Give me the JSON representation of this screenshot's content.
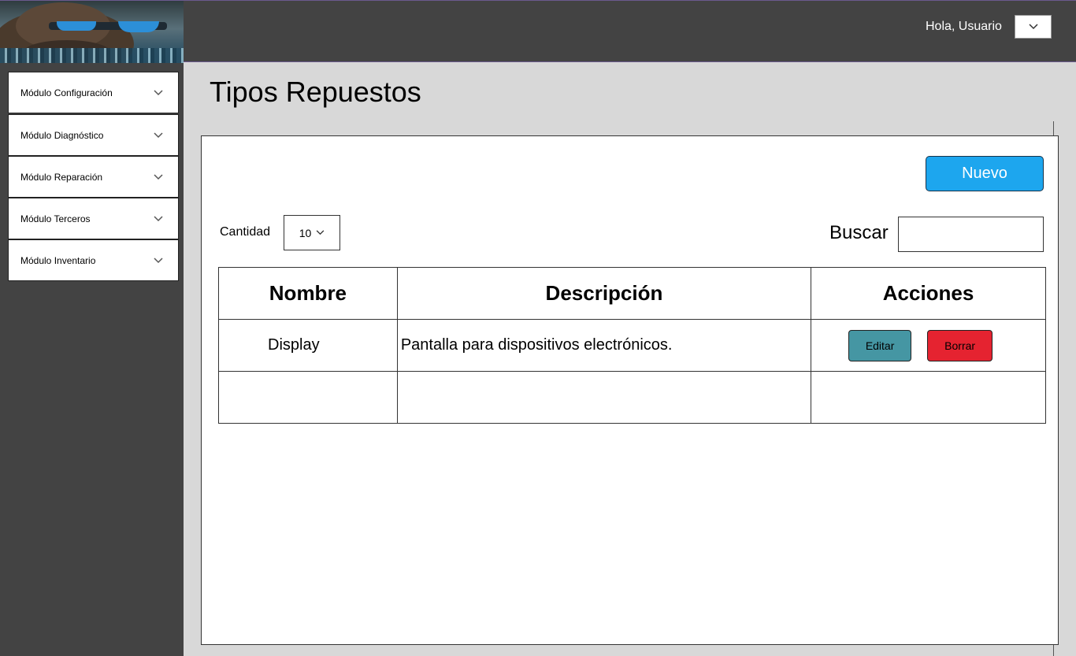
{
  "header": {
    "greeting": "Hola, Usuario",
    "colors": {
      "background": "#434343",
      "accent_border": "#6b5a8e"
    }
  },
  "sidebar": {
    "items": [
      {
        "label": "Módulo Configuración"
      },
      {
        "label": "Módulo Diagnóstico"
      },
      {
        "label": "Módulo Reparación"
      },
      {
        "label": "Módulo Terceros"
      },
      {
        "label": "Módulo Inventario"
      }
    ]
  },
  "main": {
    "title": "Tipos Repuestos",
    "new_button": "Nuevo",
    "quantity_label": "Cantidad",
    "quantity_value": "10",
    "search_label": "Buscar",
    "search_value": "",
    "table": {
      "columns": [
        "Nombre",
        "Descripción",
        "Acciones"
      ],
      "rows": [
        {
          "nombre": "Display",
          "descripcion": "Pantalla para dispositivos electrónicos.",
          "edit_label": "Editar",
          "delete_label": "Borrar"
        },
        {
          "nombre": "",
          "descripcion": ""
        }
      ]
    },
    "colors": {
      "new_button": "#1da6ee",
      "edit_button": "#4596a3",
      "delete_button": "#e52330"
    }
  }
}
